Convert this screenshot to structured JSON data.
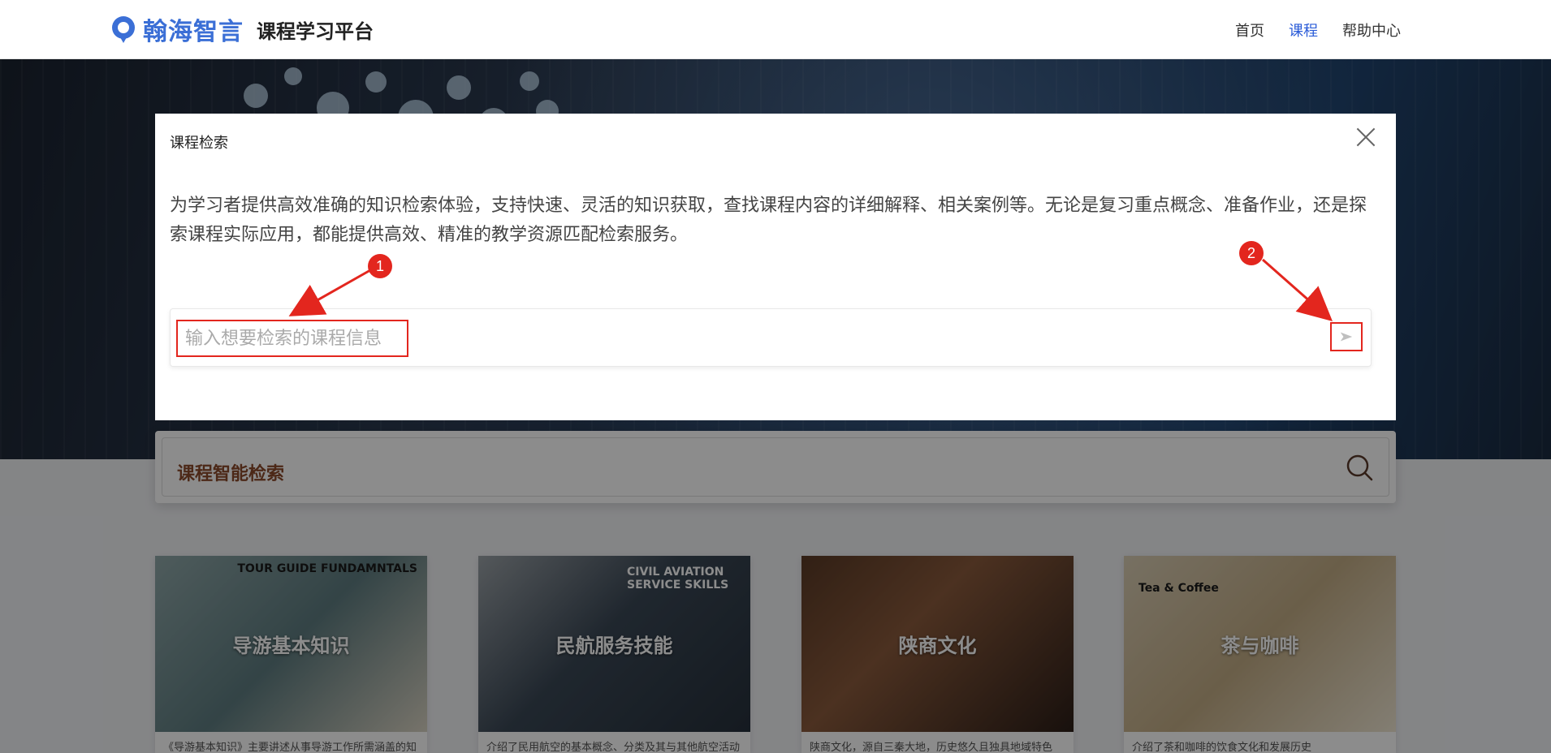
{
  "header": {
    "brand_name": "翰海智言",
    "platform_name": "课程学习平台",
    "nav": [
      {
        "label": "首页",
        "active": false
      },
      {
        "label": "课程",
        "active": true
      },
      {
        "label": "帮助中心",
        "active": false
      }
    ]
  },
  "smart_search": {
    "label": "课程智能检索",
    "icon": "search-icon"
  },
  "courses": [
    {
      "title": "导游基本知识",
      "tag": "TOUR GUIDE FUNDAMNTALS",
      "desc": "《导游基本知识》主要讲述从事导游工作所需涵盖的知",
      "color": "#6f8a8e"
    },
    {
      "title": "民航服务技能",
      "tag": "CIVIL AVIATION SERVICE SKILLS",
      "desc": "介绍了民用航空的基本概念、分类及其与其他航空活动",
      "color": "#4a5966"
    },
    {
      "title": "陕商文化",
      "tag": "",
      "desc": "陕商文化，源自三秦大地，历史悠久且独具地域特色",
      "color": "#6b4a34"
    },
    {
      "title": "茶与咖啡",
      "tag": "Tea & Coffee",
      "desc": "介绍了茶和咖啡的饮食文化和发展历史",
      "color": "#c7b89a"
    }
  ],
  "modal": {
    "title": "课程检索",
    "description": "为学习者提供高效准确的知识检索体验，支持快速、灵活的知识获取，查找课程内容的详细解释、相关案例等。无论是复习重点概念、准备作业，还是探索课程实际应用，都能提供高效、精准的教学资源匹配检索服务。",
    "search_placeholder": "输入想要检索的课程信息",
    "search_value": "",
    "send_icon": "send-icon",
    "close_icon": "close-icon"
  },
  "annotations": [
    {
      "label": "1"
    },
    {
      "label": "2"
    }
  ],
  "colors": {
    "brand": "#3b6fd6",
    "nav_active": "#2b5cd8",
    "annotation": "#e3261e",
    "smart_search_label": "#8a4a2b"
  }
}
